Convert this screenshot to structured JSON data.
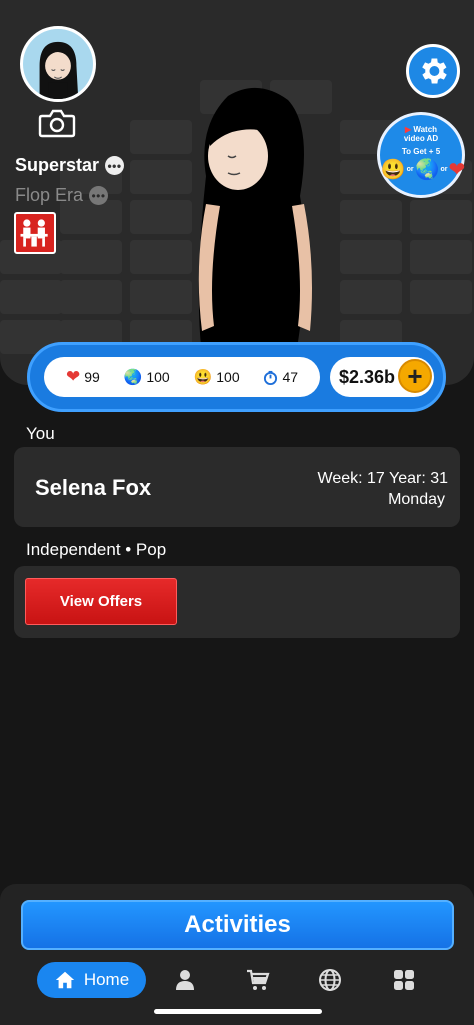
{
  "profile": {
    "avatar_icon": "avatar-icon",
    "camera_icon": "camera-icon",
    "title_primary": "Superstar",
    "title_secondary": "Flop Era",
    "more_icon": "ellipsis-icon",
    "label_icon": "record-label-icon"
  },
  "ad_button": {
    "watch_text": "Watch",
    "video_text": "video AD",
    "get_text": "To Get + 5",
    "or_text": "or"
  },
  "stats": {
    "hearts": "99",
    "world": "100",
    "happiness": "100",
    "energy": "47",
    "money": "$2.36b",
    "plus_label": "+"
  },
  "you_section": {
    "label": "You",
    "artist_name": "Selena Fox",
    "week": "Week: 17  Year: 31",
    "day": "Monday"
  },
  "label_section": {
    "label": "Independent • Pop",
    "offers_button": "View Offers"
  },
  "bottom": {
    "activities_button": "Activities",
    "nav": {
      "home_label": "Home"
    }
  },
  "colors": {
    "accent": "#1a86f0",
    "danger": "#d8231f",
    "gold": "#f5a800",
    "background": "#161616"
  }
}
